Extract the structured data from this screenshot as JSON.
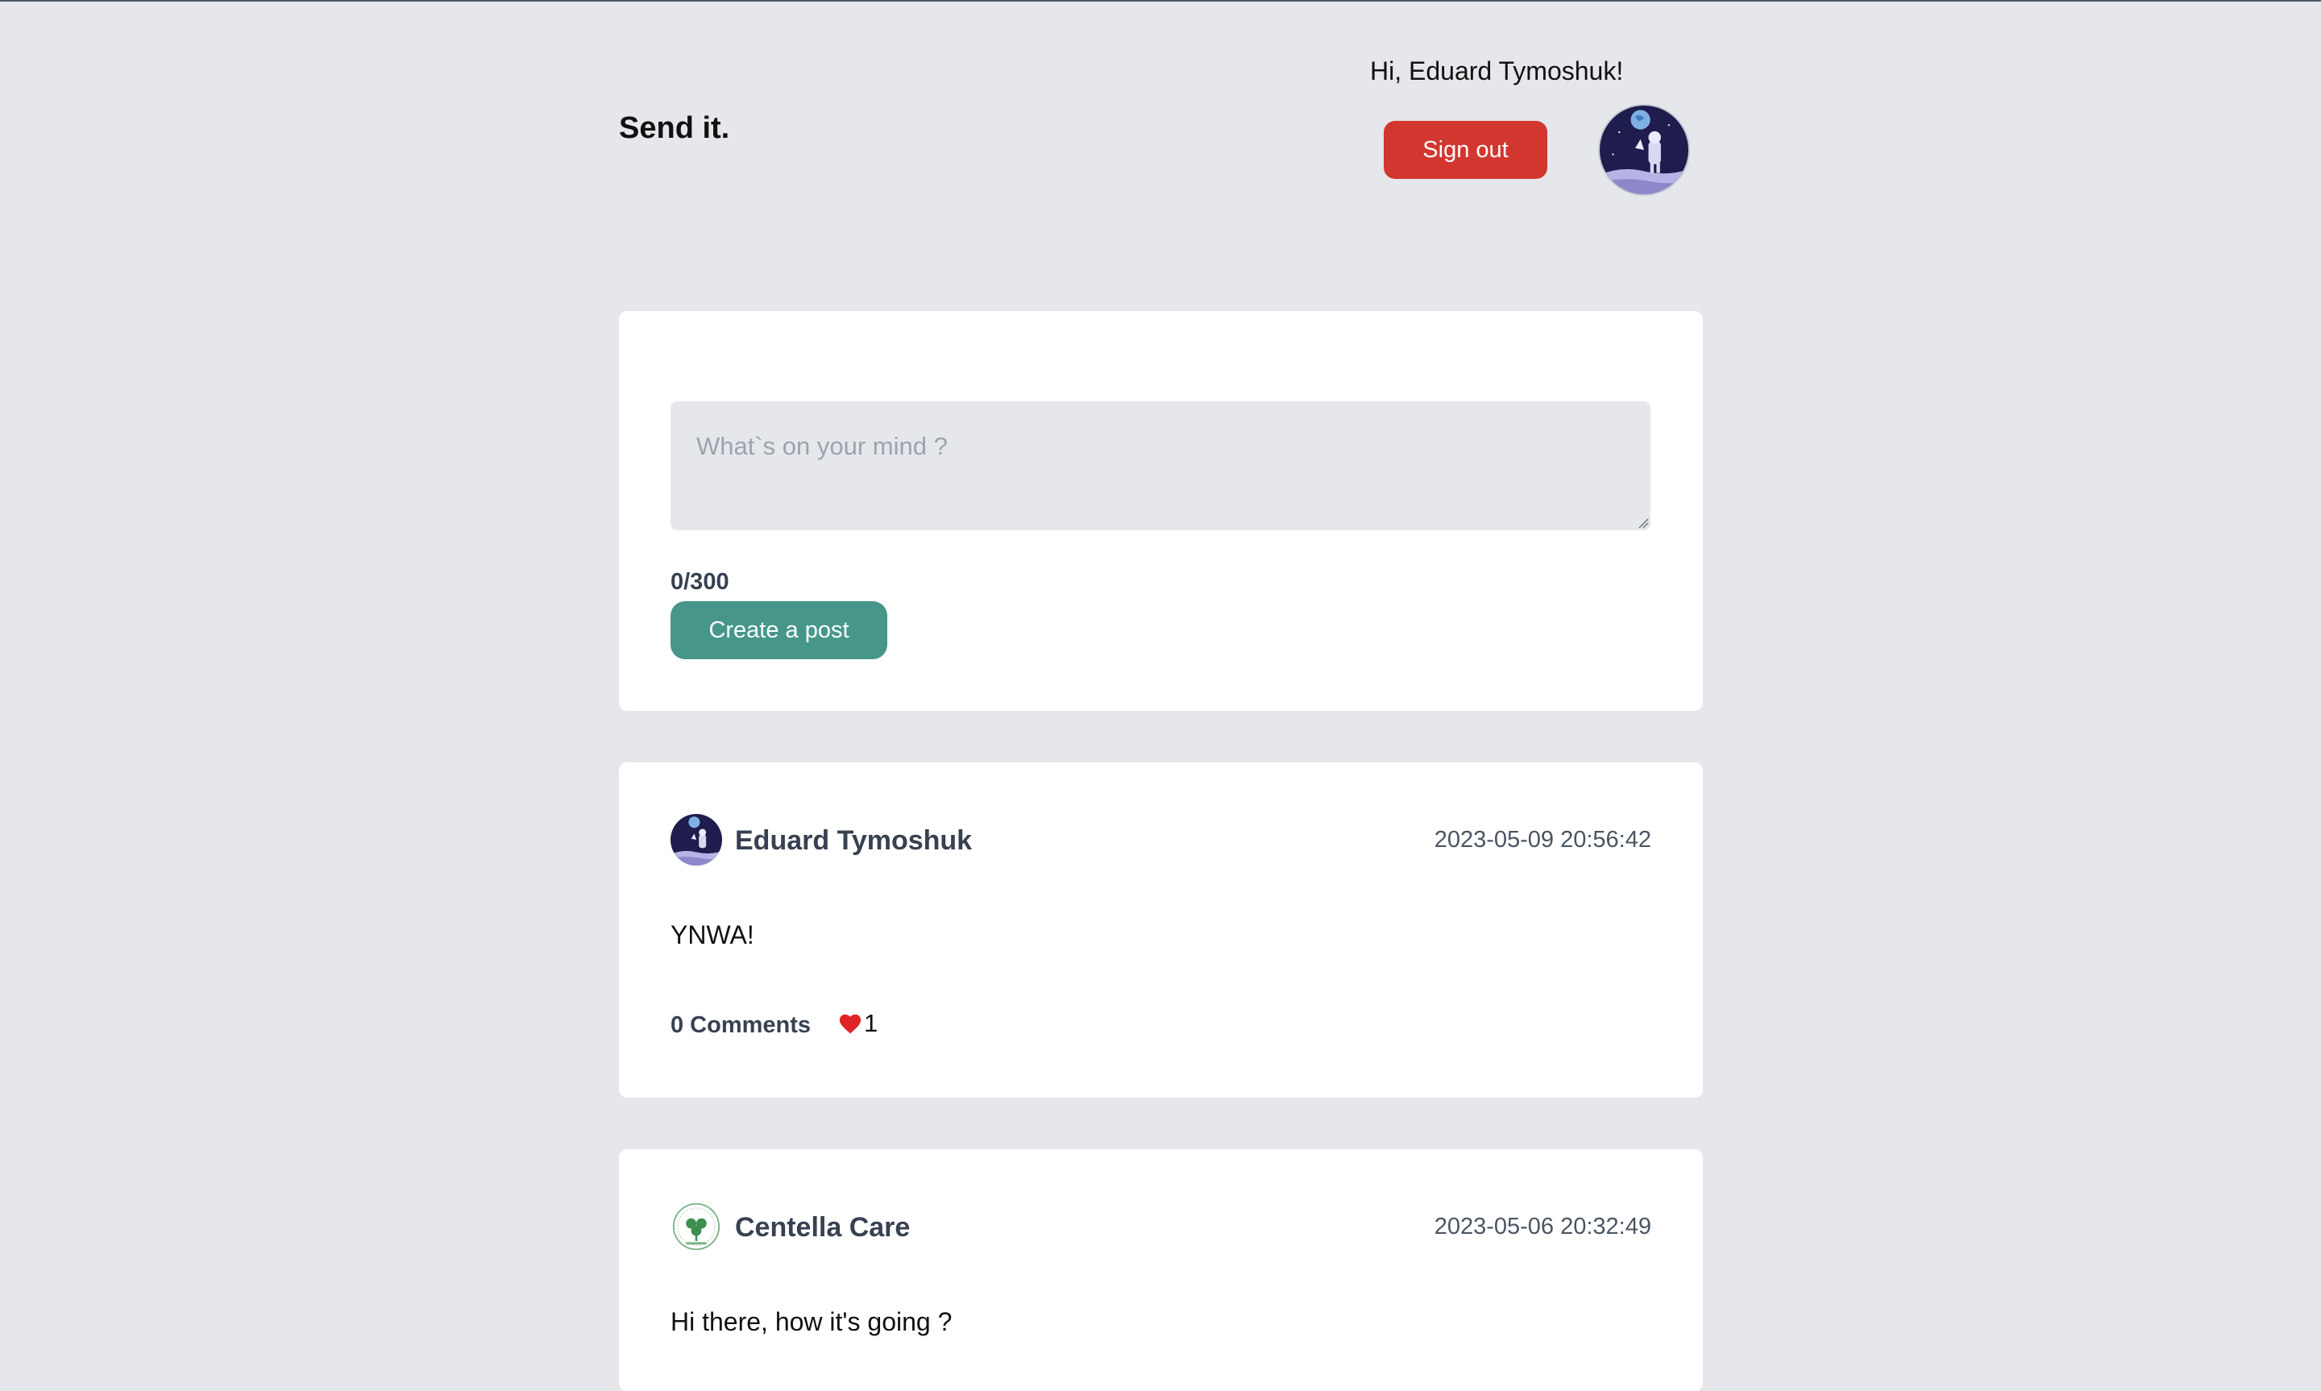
{
  "header": {
    "brand": "Send it.",
    "greeting": "Hi, Eduard Tymoshuk!",
    "sign_out_label": "Sign out"
  },
  "composer": {
    "placeholder": "What`s on your mind ?",
    "value": "",
    "counter": "0/300",
    "create_label": "Create a post"
  },
  "posts": [
    {
      "author": "Eduard Tymoshuk",
      "date": "2023-05-09 20:56:42",
      "body": "YNWA!",
      "comments_label": "0 Comments",
      "likes": "1"
    },
    {
      "author": "Centella Care",
      "date": "2023-05-06 20:32:49",
      "body": "Hi there, how it's going ?"
    }
  ],
  "colors": {
    "background": "#e5e7eb",
    "sign_out": "#d2372f",
    "create_post": "#46978a",
    "heart": "#e02424"
  }
}
